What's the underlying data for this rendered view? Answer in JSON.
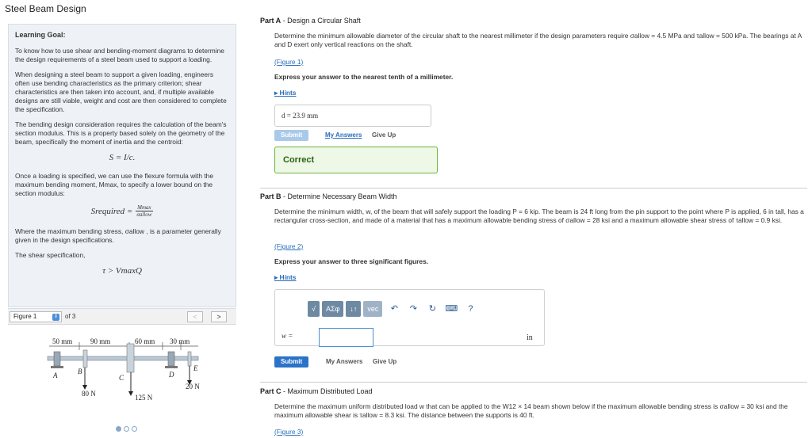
{
  "app": {
    "title": "Steel Beam Design"
  },
  "goal": {
    "heading": "Learning Goal:",
    "p1": "To know how to use shear and bending-moment diagrams to determine the design requirements of a steel beam used to support a loading.",
    "p2": "When designing a steel beam to support a given loading, engineers often use bending characteristics as the primary criterion; shear characteristics are then taken into account, and, if multiple available designs are still viable, weight and cost are then considered to complete the specification.",
    "p3": "The bending design consideration requires the calculation of the beam's section modulus. This is a property based solely on the geometry of the beam, specifically the moment of inertia and the centroid:",
    "formula1": "S = I/c.",
    "p4": "Once a loading is specified, we can use the flexure formula with the maximum bending moment, Mmax, to specify a lower bound on the section modulus:",
    "formula2_lhs": "Srequired =",
    "formula2_num": "Mmax",
    "formula2_den": "σallow",
    "p5": "Where the maximum bending stress, σallow , is a parameter generally given in the design specifications.",
    "p6": "The shear specification,",
    "formula3": "τ   >  VmaxQ"
  },
  "figure": {
    "selected": "Figure 1",
    "of_label": "of 3",
    "prev": "<",
    "next": ">",
    "dims": [
      "50 mm",
      "90 mm",
      "60 mm",
      "30 mm"
    ],
    "points": [
      "A",
      "B",
      "C",
      "D",
      "E"
    ],
    "loads": [
      "80 N",
      "125 N",
      "20 N"
    ],
    "page_count": 3,
    "active_page": 1
  },
  "partA": {
    "title_bold": "Part A",
    "title_rest": " - Design a Circular Shaft",
    "text": "Determine the minimum allowable diameter of the circular shaft to the nearest millimeter if the design parameters require σallow = 4.5 MPa and τallow = 500 kPa. The bearings at A and D exert only vertical reactions on the shaft.",
    "fig_link": "(Figure 1)",
    "instruction": "Express your answer to the nearest tenth of a millimeter.",
    "hints": "Hints",
    "answer": "d =  23.9  mm",
    "submit": "Submit",
    "my_answers": "My Answers",
    "give_up": "Give Up",
    "feedback": "Correct"
  },
  "partB": {
    "title_bold": "Part B",
    "title_rest": " - Determine Necessary Beam Width",
    "text": "Determine the minimum width, w, of the beam that will safely support the loading P = 6 kip. The beam is 24 ft long from the pin support to the point where P is applied, 6 in tall, has a rectangular cross-section, and made of a material that has a maximum allowable bending stress of σallow = 28 ksi and a maximum allowable shear stress of τallow = 0.9 ksi.",
    "fig_link": "(Figure 2)",
    "instruction": "Express your answer to three significant figures.",
    "hints": "Hints",
    "toolbar": {
      "templates": "√",
      "greek": "ΑΣφ",
      "arrows": "↓↑",
      "vec": "vec",
      "undo": "↶",
      "redo": "↷",
      "reset": "↻",
      "keyboard": "⌨",
      "help": "?"
    },
    "var_label": "w =",
    "input_value": "",
    "unit": "in",
    "submit": "Submit",
    "my_answers": "My Answers",
    "give_up": "Give Up"
  },
  "partC": {
    "title_bold": "Part C",
    "title_rest": " - Maximum Distributed Load",
    "text": "Determine the maximum uniform distributed load w that can be applied to the W12 × 14 beam shown below if the maximum allowable bending stress is σallow = 30 ksi and the maximum allowable shear is τallow = 8.3 ksi. The distance between the supports is 40 ft.",
    "fig_link": "(Figure 3)"
  }
}
